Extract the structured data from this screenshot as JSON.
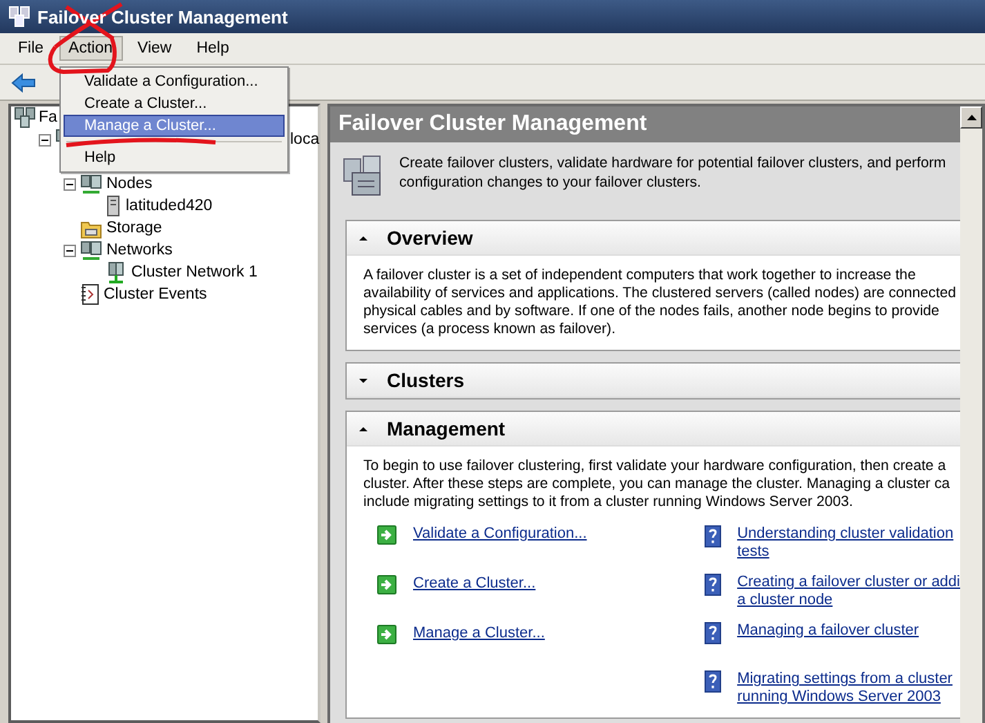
{
  "window": {
    "title": "Failover Cluster Management"
  },
  "menu_bar": [
    {
      "label": "File",
      "selected": false
    },
    {
      "label": "Action",
      "selected": true
    },
    {
      "label": "View",
      "selected": false
    },
    {
      "label": "Help",
      "selected": false
    }
  ],
  "action_menu": [
    {
      "kind": "item",
      "label": "Validate a Configuration...",
      "selected": false
    },
    {
      "kind": "item",
      "label": "Create a Cluster...",
      "selected": false
    },
    {
      "kind": "item",
      "label": "Manage a Cluster...",
      "selected": true
    },
    {
      "kind": "separator"
    },
    {
      "kind": "item",
      "label": "Help",
      "selected": false
    }
  ],
  "tree": [
    {
      "kind": "cluster",
      "label": "Fa",
      "children": [
        {
          "kind": "cluster",
          "label": "loca",
          "expanded": true,
          "children": [
            {
              "kind": "nodes",
              "label": "Nodes",
              "expanded": true,
              "children": [
                {
                  "kind": "server",
                  "label": "latituded420"
                }
              ]
            },
            {
              "kind": "storage",
              "label": "Storage"
            },
            {
              "kind": "nodes",
              "label": "Networks",
              "expanded": true,
              "children": [
                {
                  "kind": "network",
                  "label": "Cluster Network 1"
                }
              ]
            },
            {
              "kind": "events",
              "label": "Cluster Events"
            }
          ]
        }
      ]
    }
  ],
  "content": {
    "header": "Failover Cluster Management",
    "description": [
      "Create failover clusters, validate hardware for potential failover clusters, and perform",
      "configuration changes to your failover clusters."
    ],
    "sections": [
      {
        "title": "Overview",
        "expanded": true,
        "lines": [
          "A failover cluster is a set of independent computers that work together to increase the",
          "availability of services and applications. The clustered servers (called nodes) are connected",
          "physical cables and by software. If one of the nodes fails, another node begins to provide",
          "services (a process known as failover)."
        ]
      },
      {
        "title": "Clusters",
        "expanded": false
      },
      {
        "title": "Management",
        "expanded": true,
        "lines": [
          "To begin to use failover clustering, first validate your hardware configuration, then create a",
          "cluster.  After these steps are complete, you can manage the cluster.  Managing a cluster ca",
          "include migrating settings to it from a cluster running Windows Server 2003."
        ],
        "actions": [
          "Validate a Configuration...",
          "Create a Cluster...",
          "Manage a Cluster..."
        ],
        "help_links": [
          {
            "lines": [
              "Understanding cluster validation",
              "tests"
            ]
          },
          {
            "lines": [
              "Creating a failover cluster or addi",
              "a cluster node"
            ]
          },
          {
            "lines": [
              "Managing a failover cluster"
            ]
          },
          {
            "lines": [
              "Migrating settings from a cluster",
              "running Windows Server 2003"
            ]
          }
        ]
      }
    ]
  }
}
